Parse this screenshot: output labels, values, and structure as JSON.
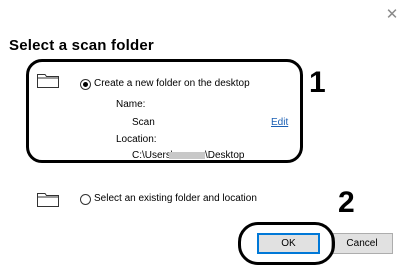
{
  "dialog": {
    "title": "Select a scan folder",
    "close_icon": "close-icon"
  },
  "option_new": {
    "label": "Create a new folder on the desktop",
    "selected": true,
    "name_label": "Name:",
    "name_value": "Scan",
    "edit_link": "Edit",
    "location_label": "Location:",
    "location_prefix": "C:\\Users\\",
    "location_suffix": "\\Desktop"
  },
  "option_existing": {
    "label": "Select an existing folder and location",
    "selected": false
  },
  "buttons": {
    "ok": "OK",
    "cancel": "Cancel"
  },
  "callouts": {
    "one": "1",
    "two": "2"
  }
}
